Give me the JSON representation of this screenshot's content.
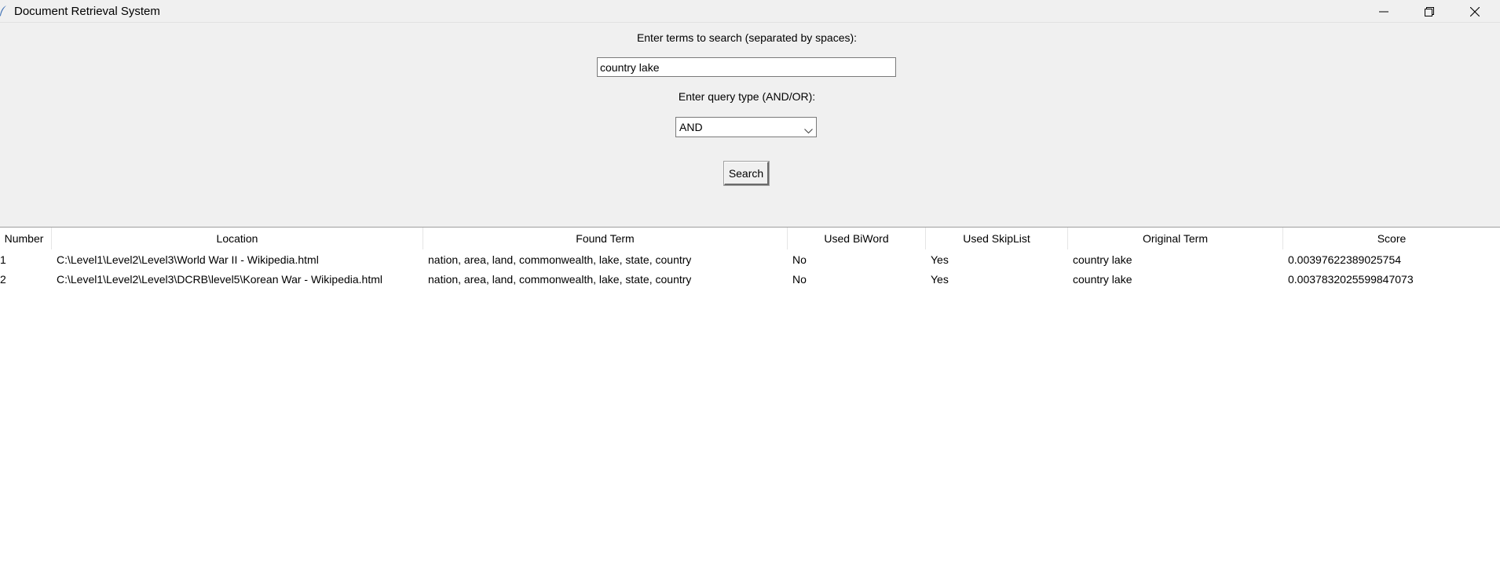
{
  "window": {
    "title": "Document Retrieval System",
    "app_icon": "feather-icon",
    "controls": [
      "minimize-icon",
      "restore-icon",
      "close-icon"
    ]
  },
  "search": {
    "terms_label": "Enter terms to search (separated by spaces):",
    "terms_value": "country lake",
    "query_type_label": "Enter query type (AND/OR):",
    "query_type_value": "AND",
    "search_button_label": "Search"
  },
  "table": {
    "columns": [
      "Number",
      "Location",
      "Found Term",
      "Used BiWord",
      "Used SkipList",
      "Original Term",
      "Score"
    ],
    "rows": [
      {
        "number": "1",
        "location": "C:\\Level1\\Level2\\Level3\\World War II - Wikipedia.html",
        "found_term": "nation, area, land, commonwealth, lake, state, country",
        "used_biword": "No",
        "used_skiplist": "Yes",
        "original_term": "country lake",
        "score": "0.00397622389025754"
      },
      {
        "number": "2",
        "location": "C:\\Level1\\Level2\\Level3\\DCRB\\level5\\Korean War - Wikipedia.html",
        "found_term": "nation, area, land, commonwealth, lake, state, country",
        "used_biword": "No",
        "used_skiplist": "Yes",
        "original_term": "country lake",
        "score": "0.0037832025599847073"
      }
    ]
  }
}
